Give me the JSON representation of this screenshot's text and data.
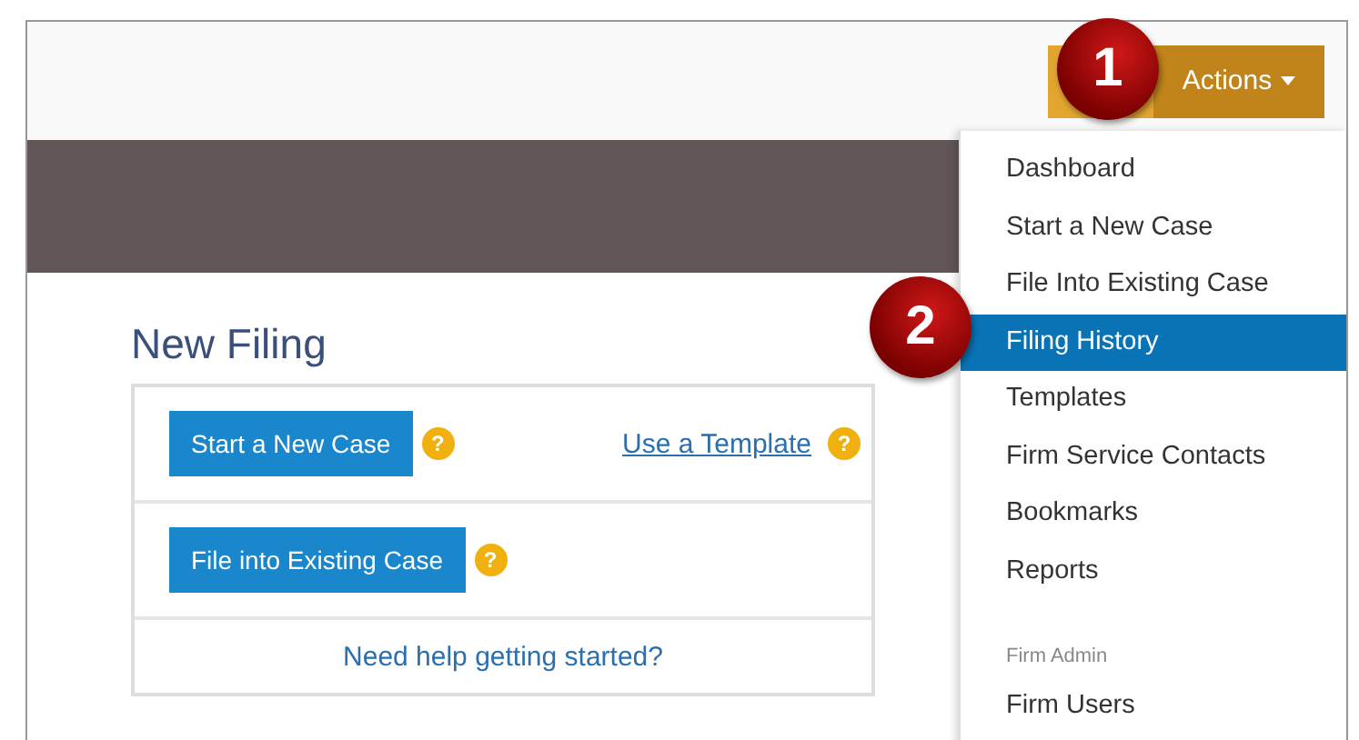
{
  "header": {
    "actions_button": {
      "label": "Actions"
    }
  },
  "badges": [
    {
      "text": "1"
    },
    {
      "text": "2"
    }
  ],
  "new_filing": {
    "title": "New Filing",
    "rows": [
      {
        "button": "Start a New Case",
        "help": "?",
        "link": "Use a Template",
        "link_help": "?"
      },
      {
        "button": "File into Existing Case",
        "help": "?"
      }
    ],
    "help_link": "Need help getting started?"
  },
  "menu": [
    {
      "kind": "item",
      "label": "Dashboard",
      "selected": false
    },
    {
      "kind": "item",
      "label": "Start a New Case",
      "selected": false
    },
    {
      "kind": "item",
      "label": "File Into Existing Case",
      "selected": false
    },
    {
      "kind": "item",
      "label": "Filing History",
      "selected": true
    },
    {
      "kind": "item",
      "label": "Templates",
      "selected": false
    },
    {
      "kind": "item",
      "label": "Firm Service Contacts",
      "selected": false
    },
    {
      "kind": "item",
      "label": "Bookmarks",
      "selected": false
    },
    {
      "kind": "item",
      "label": "Reports",
      "selected": false
    },
    {
      "kind": "header",
      "label": "Firm Admin"
    },
    {
      "kind": "item",
      "label": "Firm Users",
      "selected": false
    }
  ]
}
